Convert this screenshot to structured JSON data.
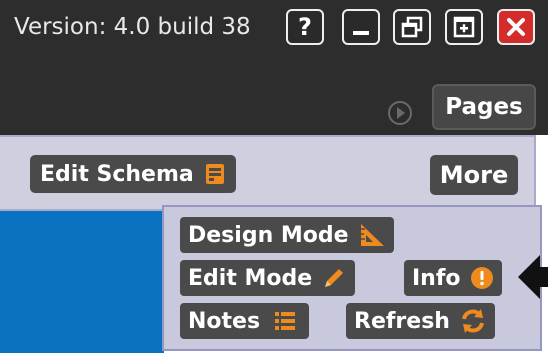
{
  "header": {
    "version": "Version: 4.0 build 38",
    "help_label": "?"
  },
  "nav": {
    "pages_label": "Pages"
  },
  "schema_bar": {
    "edit_schema_label": "Edit Schema",
    "more_label": "More"
  },
  "more_menu": {
    "design_mode": "Design Mode",
    "edit_mode": "Edit Mode",
    "info": "Info",
    "notes": "Notes",
    "refresh": "Refresh"
  },
  "colors": {
    "accent_orange": "#ee8a1e",
    "close_red": "#d42b2b",
    "content_blue": "#0a72c0"
  },
  "icons": [
    "help-icon",
    "minimize-icon",
    "restore-icon",
    "maximize-icon",
    "close-icon",
    "play-icon",
    "edit-schema-icon",
    "ruler-triangle-icon",
    "pencil-icon",
    "info-alert-icon",
    "notes-list-icon",
    "refresh-icon",
    "pointer-arrow-icon"
  ]
}
